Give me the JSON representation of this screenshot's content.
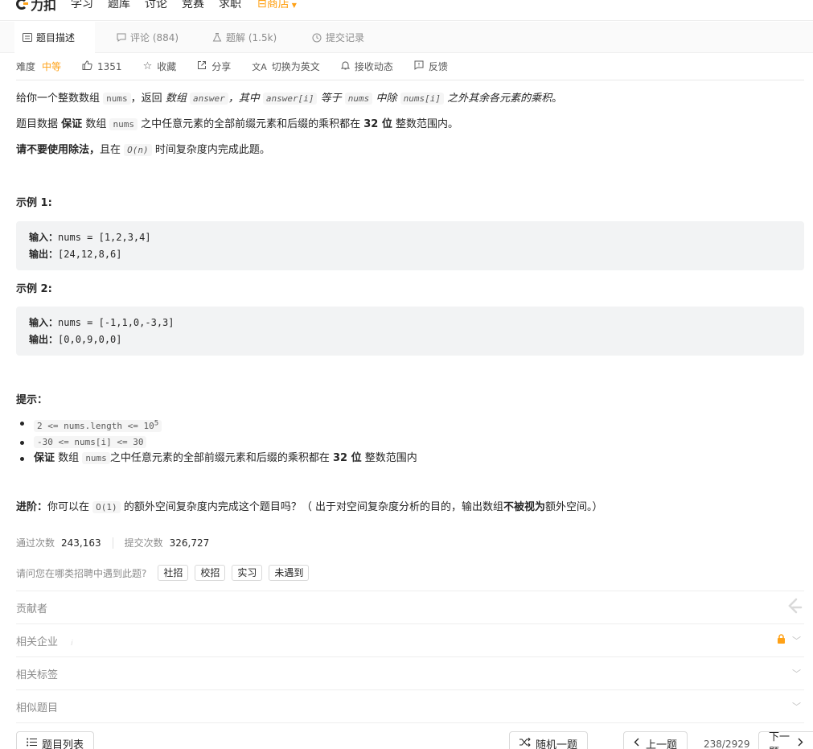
{
  "nav": {
    "logo": "力扣",
    "items": [
      "学习",
      "题库",
      "讨论",
      "竞赛",
      "求职"
    ],
    "store": "商店"
  },
  "tabs": [
    {
      "label": "题目描述"
    },
    {
      "label": "评论 (884)"
    },
    {
      "label": "题解 (1.5k)"
    },
    {
      "label": "提交记录"
    }
  ],
  "meta": {
    "difficulty_label": "难度",
    "difficulty": "中等",
    "likes": "1351",
    "favorite": "收藏",
    "share": "分享",
    "switch_lang": "切换为英文",
    "subscribe": "接收动态",
    "feedback": "反馈"
  },
  "description": {
    "p1_a": "给你一个整数数组",
    "p1_nums": "nums",
    "p1_b": "，返回",
    "p1_c": "数组",
    "p1_answer": "answer",
    "p1_d": "，其中",
    "p1_answer_i": "answer[i]",
    "p1_e": "等于",
    "p1_nums2": "nums",
    "p1_f": "中除",
    "p1_nums_i": "nums[i]",
    "p1_g": "之外其余各元素的乘积",
    "p1_h": "。",
    "p2_a": "题目数据",
    "p2_bold": "保证",
    "p2_b": "数组",
    "p2_nums": "nums",
    "p2_c": "之中任意元素的全部前缀元素和后缀的乘积都在",
    "p2_bold2": "32 位",
    "p2_d": "整数范围内。",
    "p3_bold": "请不要使用除法，",
    "p3_a": "且在",
    "p3_code": "O(n)",
    "p3_b": "时间复杂度内完成此题。"
  },
  "examples": [
    {
      "title": "示例 1:",
      "input_label": "输入：",
      "input": "nums = [1,2,3,4]",
      "output_label": "输出：",
      "output": "[24,12,8,6]"
    },
    {
      "title": "示例 2:",
      "input_label": "输入：",
      "input": "nums = [-1,1,0,-3,3]",
      "output_label": "输出：",
      "output": "[0,0,9,0,0]"
    }
  ],
  "constraints": {
    "title": "提示：",
    "c1": "2 <= nums.length <= 10",
    "c1_sup": "5",
    "c2": "-30 <= nums[i] <= 30",
    "c3_bold": "保证",
    "c3_a": "数组",
    "c3_code": "nums",
    "c3_b": "之中任意元素的全部前缀元素和后缀的乘积都在",
    "c3_bold2": "32 位",
    "c3_c": "整数范围内"
  },
  "advanced": {
    "bold": "进阶：",
    "a": "你可以在",
    "code": "O(1)",
    "b": "的额外空间复杂度内完成这个题目吗？（ 出于对空间复杂度分析的目的，输出数组",
    "bold2": "不被视为",
    "c": "额外空间。）"
  },
  "stats": {
    "accepted_label": "通过次数",
    "accepted": "243,163",
    "submissions_label": "提交次数",
    "submissions": "326,727"
  },
  "interview": {
    "question": "请问您在哪类招聘中遇到此题?",
    "chips": [
      "社招",
      "校招",
      "实习",
      "未遇到"
    ]
  },
  "sections": {
    "contributors": "贡献者",
    "companies": "相关企业",
    "tags": "相关标签",
    "similar": "相似题目"
  },
  "footer": {
    "problem_list": "题目列表",
    "random": "随机一题",
    "prev": "上一题",
    "pager": "238/2929",
    "next": "下一题"
  },
  "colors": {
    "accent": "#ffa116",
    "code_bg": "#f2f3f4"
  }
}
